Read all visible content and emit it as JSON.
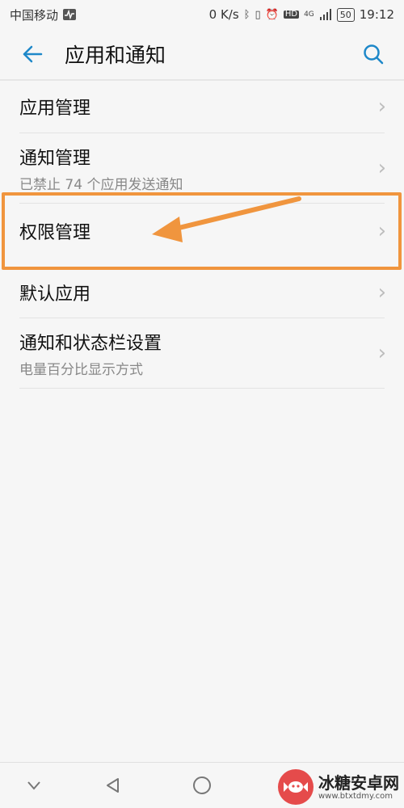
{
  "status_bar": {
    "carrier": "中国移动",
    "speed": "0 K/s",
    "battery": "50",
    "time": "19:12",
    "icons": [
      "activity-icon",
      "bluetooth-icon",
      "vibrate-icon",
      "alarm-icon",
      "hd-icon",
      "4g-icon",
      "signal-icon",
      "battery-icon"
    ]
  },
  "header": {
    "title": "应用和通知",
    "back_icon": "arrow-left-icon",
    "search_icon": "search-icon"
  },
  "items": [
    {
      "label": "应用管理",
      "sub": ""
    },
    {
      "label": "通知管理",
      "sub": "已禁止 74 个应用发送通知"
    },
    {
      "label": "权限管理",
      "sub": ""
    },
    {
      "label": "默认应用",
      "sub": ""
    },
    {
      "label": "通知和状态栏设置",
      "sub": "电量百分比显示方式"
    }
  ],
  "annotation": {
    "color": "#f0953e"
  },
  "watermark": {
    "title": "冰糖安卓网",
    "url": "www.btxtdmy.com"
  },
  "colors": {
    "accent": "#1e88c9",
    "background": "#f6f6f6"
  }
}
